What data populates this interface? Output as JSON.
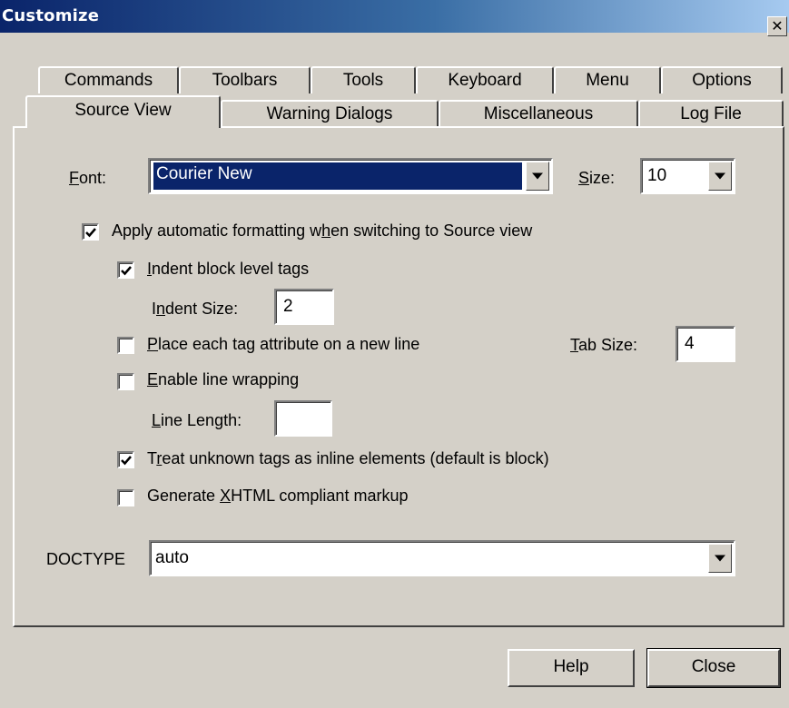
{
  "window": {
    "title": "Customize",
    "close_glyph": "✕"
  },
  "tabs_back": [
    "Commands",
    "Toolbars",
    "Tools",
    "Keyboard",
    "Menu",
    "Options"
  ],
  "tabs_front": [
    "Source View",
    "Warning Dialogs",
    "Miscellaneous",
    "Log File"
  ],
  "active_tab": "Source View",
  "font": {
    "label": "Font:",
    "value": "Courier New"
  },
  "size": {
    "label": "Size:",
    "value": "10"
  },
  "apply_formatting": {
    "label": "Apply automatic formatting when switching to Source view",
    "checked": true
  },
  "indent_block": {
    "label": "Indent block level tags",
    "checked": true
  },
  "indent_size": {
    "label": "Indent Size:",
    "value": "2"
  },
  "place_attr": {
    "label": "Place each tag attribute on a new line",
    "checked": false
  },
  "tab_size": {
    "label": "Tab Size:",
    "value": "4"
  },
  "line_wrap": {
    "label": "Enable line wrapping",
    "checked": false
  },
  "line_length": {
    "label": "Line Length:",
    "value": ""
  },
  "treat_unknown": {
    "label": "Treat unknown tags as inline elements (default is block)",
    "checked": true
  },
  "xhtml": {
    "label": "Generate XHTML compliant markup",
    "checked": false
  },
  "doctype": {
    "label": "DOCTYPE",
    "value": "auto"
  },
  "buttons": {
    "help": "Help",
    "close": "Close"
  }
}
